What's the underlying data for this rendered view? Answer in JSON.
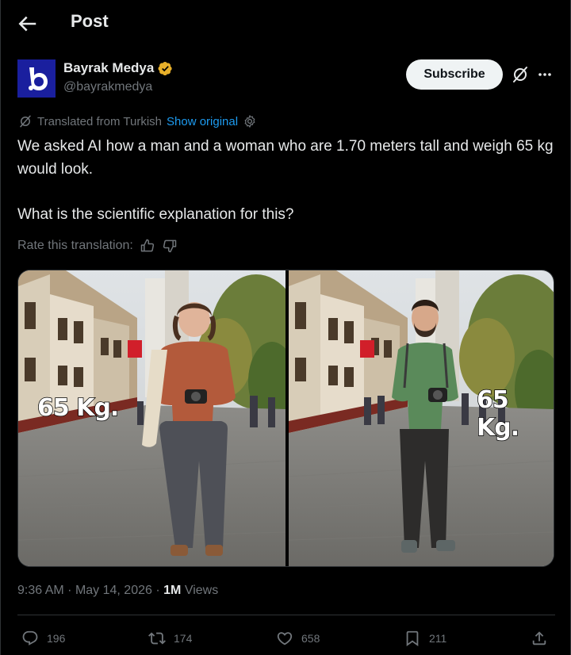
{
  "header": {
    "title": "Post"
  },
  "author": {
    "name": "Bayrak Medya",
    "handle": "@bayrakmedya",
    "avatar_letter": "b"
  },
  "subscribe_label": "Subscribe",
  "translation": {
    "note": "Translated from Turkish",
    "show_original": "Show original",
    "rate_label": "Rate this translation:"
  },
  "post": {
    "paragraph1": "We asked AI how a man and a woman who are 1.70 meters tall and weigh 65 kg would look.",
    "paragraph2": "What is the scientific explanation for this?"
  },
  "media": {
    "left_label": "65 Kg.",
    "right_label": "65 Kg."
  },
  "meta": {
    "time": "9:36 AM",
    "separator": "·",
    "date": "May 14, 2026",
    "views_count": "1M",
    "views_label": "Views"
  },
  "actions": {
    "replies": "196",
    "reposts": "174",
    "likes": "658",
    "bookmarks": "211"
  },
  "colors": {
    "background": "#000000",
    "accent": "#1d9bf0",
    "muted": "#71767b",
    "verified": "#e8b02a",
    "avatar": "#1a1f9e"
  }
}
